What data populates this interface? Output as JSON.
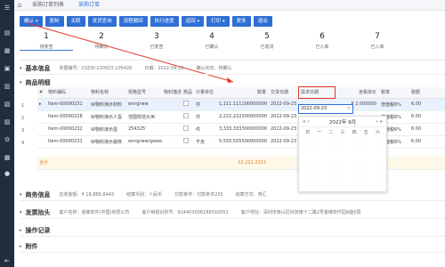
{
  "topbar": {
    "tabs": [
      "采购订单列表",
      "采购订单"
    ]
  },
  "toolbar": {
    "buttons": [
      "确认",
      "复制",
      "关联",
      "发货查询",
      "流程撤回",
      "执行进度",
      "返回",
      "打印",
      "更多",
      "退出"
    ]
  },
  "steps": [
    {
      "num": "1",
      "label": "待复查"
    },
    {
      "num": "2",
      "label": "待确认"
    },
    {
      "num": "3",
      "label": "已复查"
    },
    {
      "num": "4",
      "label": "已确认"
    },
    {
      "num": "5",
      "label": "已收货"
    },
    {
      "num": "6",
      "label": "已入库"
    },
    {
      "num": "7",
      "label": "已入库"
    }
  ],
  "basic_info": {
    "title": "基本信息",
    "fields": [
      "单据编号：CGDD-220923-105426",
      "日期：2022-09-23",
      "确认状态：待确认"
    ]
  },
  "goods": {
    "title": "商品明细"
  },
  "table": {
    "headers": [
      "#",
      "物料编码",
      "物料名称",
      "规格型号",
      "物料描述",
      "赠品",
      "计量单位",
      "数量",
      "交货日期",
      "需求日期",
      "",
      "含税单价",
      "税率",
      "税额"
    ],
    "rows": [
      {
        "idx": "1",
        "code": "Item-00000231",
        "name": "W物料演示材料",
        "spec": "wnrgrww",
        "unit": "件",
        "qty": "1,111.111100000000",
        "date": "2022-09-23",
        "need": "2022-09-23",
        "price": "¥ 2.000000",
        "rate": "增值税6%",
        "tax": "6.00"
      },
      {
        "idx": "2",
        "code": "Item-00000228",
        "name": "W物料演示人蛋",
        "spec": "范围规范大Ж",
        "unit": "件",
        "qty": "2,222.222200000000",
        "date": "2022-09-23",
        "need": "",
        "price": "",
        "rate": "增值税6%",
        "tax": "6.00"
      },
      {
        "idx": "3",
        "code": "Item-00000232",
        "name": "W物料演示蛋",
        "spec": "254325'",
        "unit": "件",
        "qty": "3,333.333300000000",
        "date": "2022-09-23",
        "need": "",
        "price": "",
        "rate": "增值税6%",
        "tax": "6.00"
      },
      {
        "idx": "4",
        "code": "Item-00000231",
        "name": "W物料演示装修",
        "spec": "wnrgrwwrgwww",
        "unit": "千克",
        "qty": "5,555.555500000000",
        "date": "2022-09-23",
        "need": "",
        "price": "",
        "rate": "增值税6%",
        "tax": "6.00"
      }
    ],
    "sum_label": "合计",
    "sum_value": "12,222.2221"
  },
  "date_picker": {
    "value": "2022-09-23",
    "year": "2022年",
    "month": "9月",
    "nav_prev": "« ‹",
    "nav_next": "› »",
    "weekdays": [
      "日",
      "一",
      "二",
      "三",
      "四",
      "五",
      "六"
    ]
  },
  "business": {
    "title": "商务信息",
    "fields": [
      "应收金额：¥ 18,888.8443",
      "结算币别：人民币",
      "付款条件：付款条件235",
      "结算方式：电汇"
    ]
  },
  "invoice": {
    "title": "发票抬头",
    "fields": [
      "客户名称：金蝶软件(中国)有限公司",
      "客户纳税识别号：914403006188592052",
      "客户地址：深圳市南山区科技南十二路2号金蝶软件园A座6层"
    ]
  },
  "operations": {
    "title": "操作记录"
  },
  "attachments": {
    "title": "附件"
  },
  "colors": {
    "primary": "#2f6fd6",
    "sidebar": "#1f2d3d",
    "highlight": "#e0342a"
  }
}
